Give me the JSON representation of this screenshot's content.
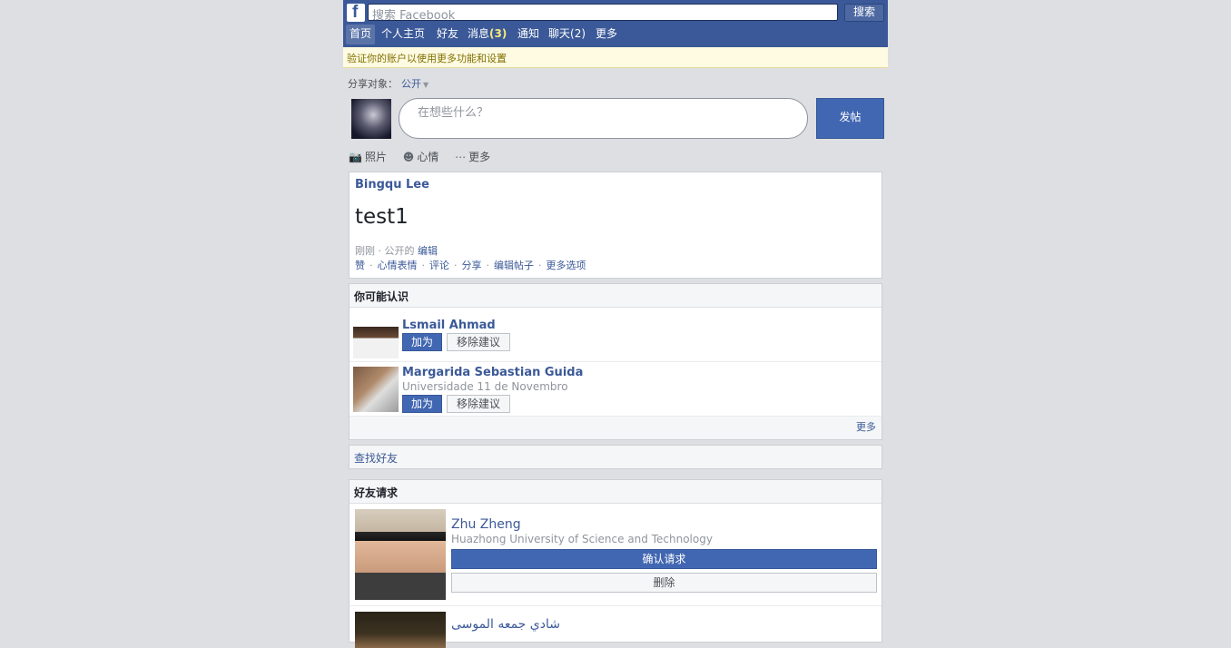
{
  "header": {
    "logo": "f",
    "search_placeholder": "搜索 Facebook",
    "search_button": "搜索",
    "tabs": [
      {
        "label": "首页",
        "count": ""
      },
      {
        "label": "个人主页",
        "count": ""
      },
      {
        "label": "好友",
        "count": ""
      },
      {
        "label": "消息",
        "count": "(3)"
      },
      {
        "label": "通知",
        "count": ""
      },
      {
        "label": "聊天",
        "count": "(2)"
      },
      {
        "label": "更多",
        "count": ""
      }
    ]
  },
  "notice": {
    "text": "验证你的账户以使用更多功能和设置"
  },
  "composer": {
    "audience_label": "分享对象：",
    "audience_value": "公开",
    "placeholder": "在想些什么？",
    "post_button": "发帖",
    "tools": [
      {
        "icon": "camera-icon",
        "label": "照片"
      },
      {
        "icon": "smiley-icon",
        "label": "心情"
      },
      {
        "icon": "more-icon",
        "label": "更多"
      }
    ]
  },
  "story": {
    "author": "Bingqu Lee",
    "text": "test1",
    "meta_time": "刚刚",
    "meta_privacy": "公开的",
    "meta_link": "编辑",
    "actions": [
      "赞",
      "心情表情",
      "评论",
      "分享",
      "编辑帖子",
      "更多选项"
    ]
  },
  "pymk": {
    "title": "你可能认识",
    "see_all": "更多",
    "add_label": "加为",
    "remove_label": "移除建议",
    "people": [
      {
        "name": "Lsmail Ahmad",
        "sub": ""
      },
      {
        "name": "Margarida Sebastian Guida",
        "sub": "Universidade 11 de Novembro"
      }
    ]
  },
  "search_friends": {
    "title": "查找好友"
  },
  "friend_requests": {
    "title": "好友请求",
    "confirm_label": "确认请求",
    "delete_label": "删除",
    "people": [
      {
        "name": "Zhu Zheng",
        "sub": "Huazhong University of Science and Technology"
      },
      {
        "name": "شادي جمعه الموسى",
        "sub": ""
      }
    ]
  }
}
